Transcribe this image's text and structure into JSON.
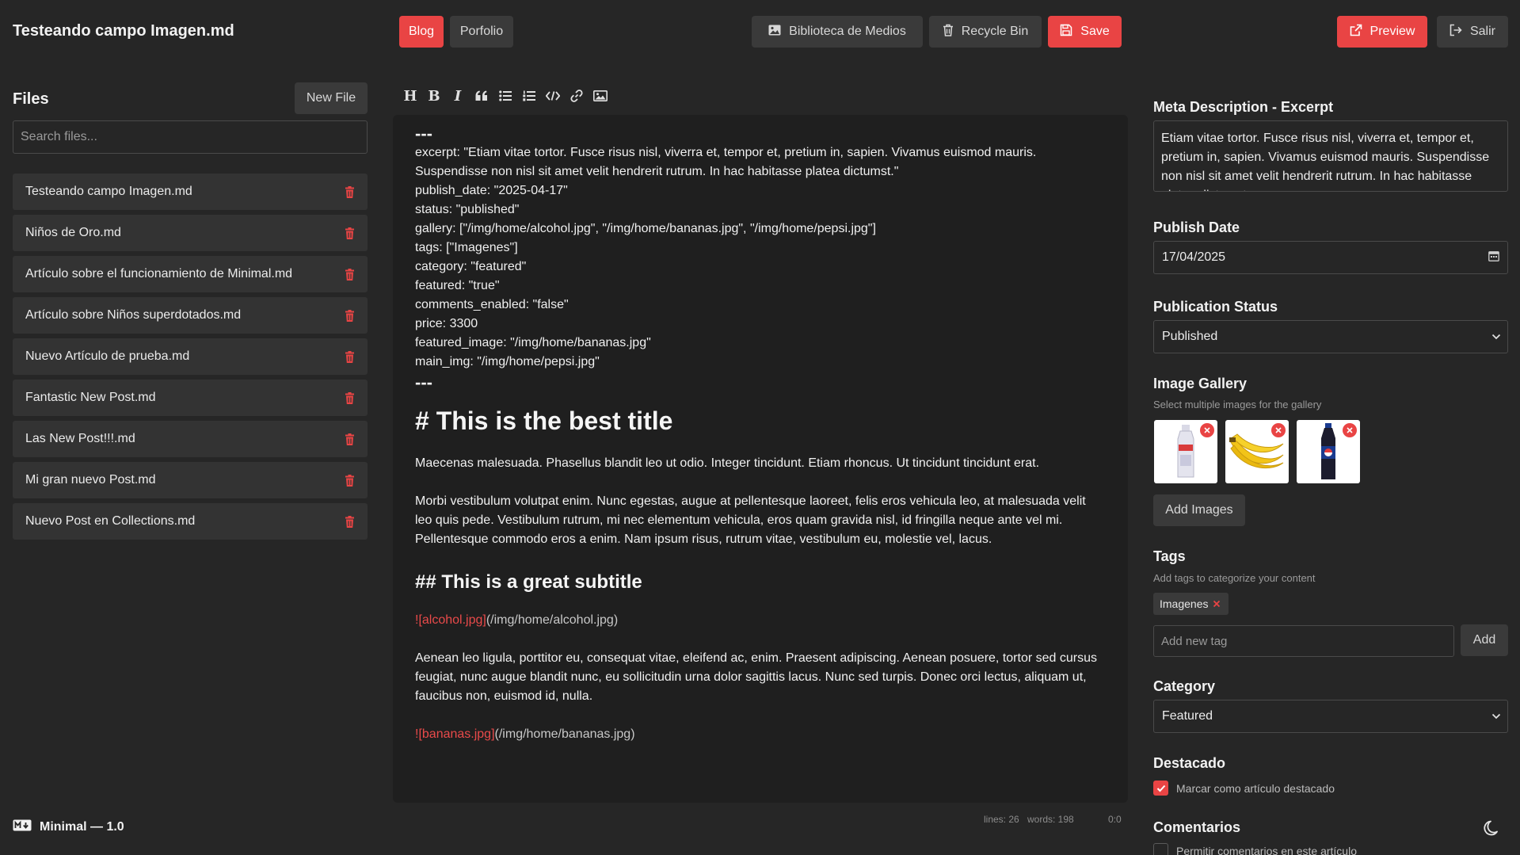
{
  "header": {
    "title": "Testeando campo Imagen.md",
    "collections": [
      "Blog",
      "Porfolio"
    ],
    "media_library_label": "Biblioteca de Medios",
    "recycle_bin_label": "Recycle Bin",
    "save_label": "Save",
    "preview_label": "Preview",
    "exit_label": "Salir"
  },
  "sidebar": {
    "heading": "Files",
    "new_file_label": "New File",
    "search_placeholder": "Search files...",
    "files": [
      "Testeando campo Imagen.md",
      "Niños de Oro.md",
      "Artículo sobre el funcionamiento de Minimal.md",
      "Artículo sobre Niños superdotados.md",
      "Nuevo Artículo de prueba.md",
      "Fantastic New Post.md",
      "Las New Post!!!.md",
      "Mi gran nuevo Post.md",
      "Nuevo Post en Collections.md"
    ]
  },
  "footer": {
    "brand": "Minimal — 1.0",
    "lines": "lines: 26",
    "words": "words: 198",
    "cursor": "0:0"
  },
  "toolbar": [
    "heading",
    "bold",
    "italic",
    "quote",
    "unordered-list",
    "ordered-list",
    "code",
    "link",
    "image"
  ],
  "editor": {
    "frontmatter_open": "---",
    "frontmatter": [
      "excerpt: \"Etiam vitae tortor. Fusce risus nisl, viverra et, tempor et, pretium in, sapien. Vivamus euismod mauris. Suspendisse non nisl sit amet velit hendrerit rutrum. In hac habitasse platea dictumst.\"",
      "publish_date: \"2025-04-17\"",
      "status: \"published\"",
      "gallery: [\"/img/home/alcohol.jpg\", \"/img/home/bananas.jpg\", \"/img/home/pepsi.jpg\"]",
      "tags: [\"Imagenes\"]",
      "category: \"featured\"",
      "featured: \"true\"",
      "comments_enabled: \"false\"",
      "price: 3300",
      "featured_image: \"/img/home/bananas.jpg\"",
      "main_img: \"/img/home/pepsi.jpg\""
    ],
    "frontmatter_close": "---",
    "h1": "# This is the best title",
    "para1": "Maecenas malesuada. Phasellus blandit leo ut odio. Integer tincidunt. Etiam rhoncus. Ut tincidunt tincidunt erat.",
    "para2": "Morbi vestibulum volutpat enim. Nunc egestas, augue at pellentesque laoreet, felis eros vehicula leo, at malesuada velit leo quis pede. Vestibulum rutrum, mi nec elementum vehicula, eros quam gravida nisl, id fringilla neque ante vel mi. Pellentesque commodo eros a enim. Nam ipsum risus, rutrum vitae, vestibulum eu, molestie vel, lacus.",
    "h2": "## This is a great subtitle",
    "img1_link": "![alcohol.jpg]",
    "img1_url": "(/img/home/alcohol.jpg)",
    "para3": "Aenean leo ligula, porttitor eu, consequat vitae, eleifend ac, enim. Praesent adipiscing. Aenean posuere, tortor sed cursus feugiat, nunc augue blandit nunc, eu sollicitudin urna dolor sagittis lacus. Nunc sed turpis. Donec orci lectus, aliquam ut, faucibus non, euismod id, nulla.",
    "img2_link": "![bananas.jpg]",
    "img2_url": "(/img/home/bananas.jpg)"
  },
  "panel": {
    "excerpt_label": "Meta Description - Excerpt",
    "excerpt_value": "Etiam vitae tortor. Fusce risus nisl, viverra et, tempor et, pretium in, sapien. Vivamus euismod mauris. Suspendisse non nisl sit amet velit hendrerit rutrum. In hac habitasse platea dictumst.",
    "publish_date_label": "Publish Date",
    "publish_date_value": "17/04/2025",
    "status_label": "Publication Status",
    "status_value": "Published",
    "gallery_label": "Image Gallery",
    "gallery_help": "Select multiple images for the gallery",
    "add_images_label": "Add Images",
    "tags_label": "Tags",
    "tags_help": "Add tags to categorize your content",
    "tags": [
      "Imagenes"
    ],
    "new_tag_placeholder": "Add new tag",
    "add_tag_label": "Add",
    "category_label": "Category",
    "category_value": "Featured",
    "featured_label": "Destacado",
    "featured_checkbox_label": "Marcar como artículo destacado",
    "featured_checked": true,
    "comments_label": "Comentarios",
    "comments_checkbox_label": "Permitir comentarios en este artículo",
    "comments_checked": false
  },
  "colors": {
    "accent": "#e94444",
    "background": "#262626",
    "editor_background": "#1f1f1f"
  }
}
